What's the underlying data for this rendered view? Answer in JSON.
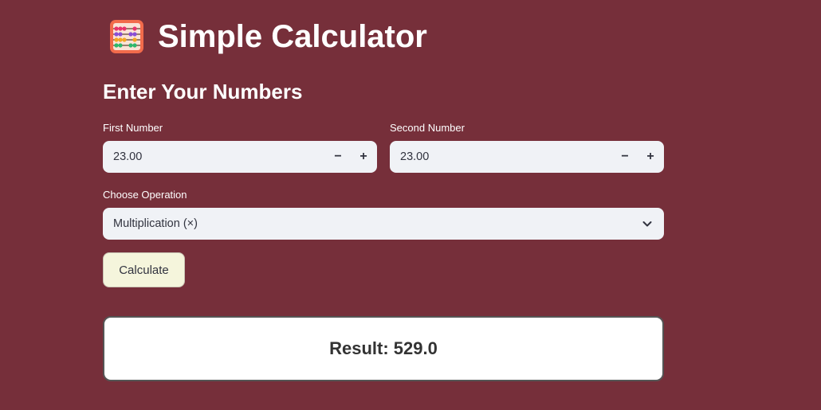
{
  "header": {
    "title": "Simple Calculator",
    "icon": "abacus-icon"
  },
  "inputs_section": {
    "heading": "Enter Your Numbers",
    "first_number": {
      "label": "First Number",
      "value": "23.00",
      "decrement_label": "−",
      "increment_label": "+"
    },
    "second_number": {
      "label": "Second Number",
      "value": "23.00",
      "decrement_label": "−",
      "increment_label": "+"
    }
  },
  "operation": {
    "label": "Choose Operation",
    "selected": "Multiplication (×)",
    "icon": "chevron-down-icon"
  },
  "calculate_button": {
    "label": "Calculate",
    "bg_color": "#f5f5dc"
  },
  "result": {
    "text": "Result: 529.0"
  },
  "colors": {
    "background": "#762f3a",
    "input_background": "#f0f2f6",
    "result_background": "#ffffff"
  }
}
